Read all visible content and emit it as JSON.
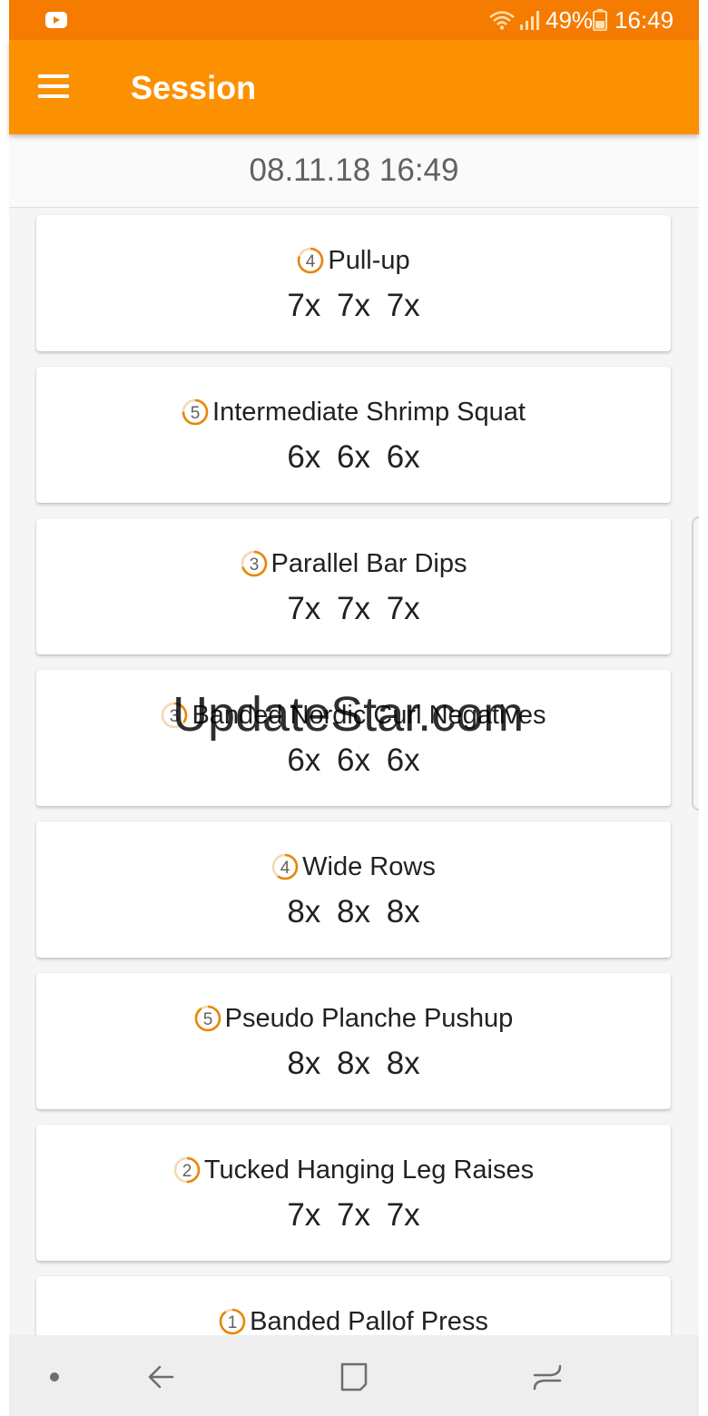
{
  "status_bar": {
    "battery_percent": "49%",
    "time": "16:49",
    "icons": [
      "youtube-icon",
      "wifi-icon",
      "signal-icon",
      "battery-icon"
    ]
  },
  "app_bar": {
    "title": "Session",
    "menu_icon": "hamburger-menu-icon"
  },
  "session": {
    "date": "08.11.18 16:49"
  },
  "exercises": [
    {
      "level": "4",
      "level_fraction": 0.8,
      "name": "Pull-up",
      "sets": "7x  7x  7x"
    },
    {
      "level": "5",
      "level_fraction": 0.75,
      "name": "Intermediate Shrimp Squat",
      "sets": "6x  6x  6x"
    },
    {
      "level": "3",
      "level_fraction": 0.7,
      "name": "Parallel Bar Dips",
      "sets": "7x  7x  7x"
    },
    {
      "level": "3",
      "level_fraction": 0.35,
      "name": "Banded Nordic Curl Negatives",
      "sets": "6x  6x  6x"
    },
    {
      "level": "4",
      "level_fraction": 0.6,
      "name": "Wide Rows",
      "sets": "8x  8x  8x"
    },
    {
      "level": "5",
      "level_fraction": 0.9,
      "name": "Pseudo Planche Pushup",
      "sets": "8x  8x  8x"
    },
    {
      "level": "2",
      "level_fraction": 0.5,
      "name": "Tucked Hanging Leg Raises",
      "sets": "7x  7x  7x"
    },
    {
      "level": "1",
      "level_fraction": 0.9,
      "name": "Banded Pallof Press",
      "sets": ""
    }
  ],
  "watermark": "UpdateStar.com",
  "colors": {
    "status_bar": "#f57c00",
    "app_bar": "#fb9100",
    "accent": "#e8870a",
    "list_background": "#f5f5f5"
  },
  "nav_bar": {
    "icons": [
      "dot-icon",
      "back-icon",
      "home-icon",
      "recent-apps-icon"
    ]
  }
}
